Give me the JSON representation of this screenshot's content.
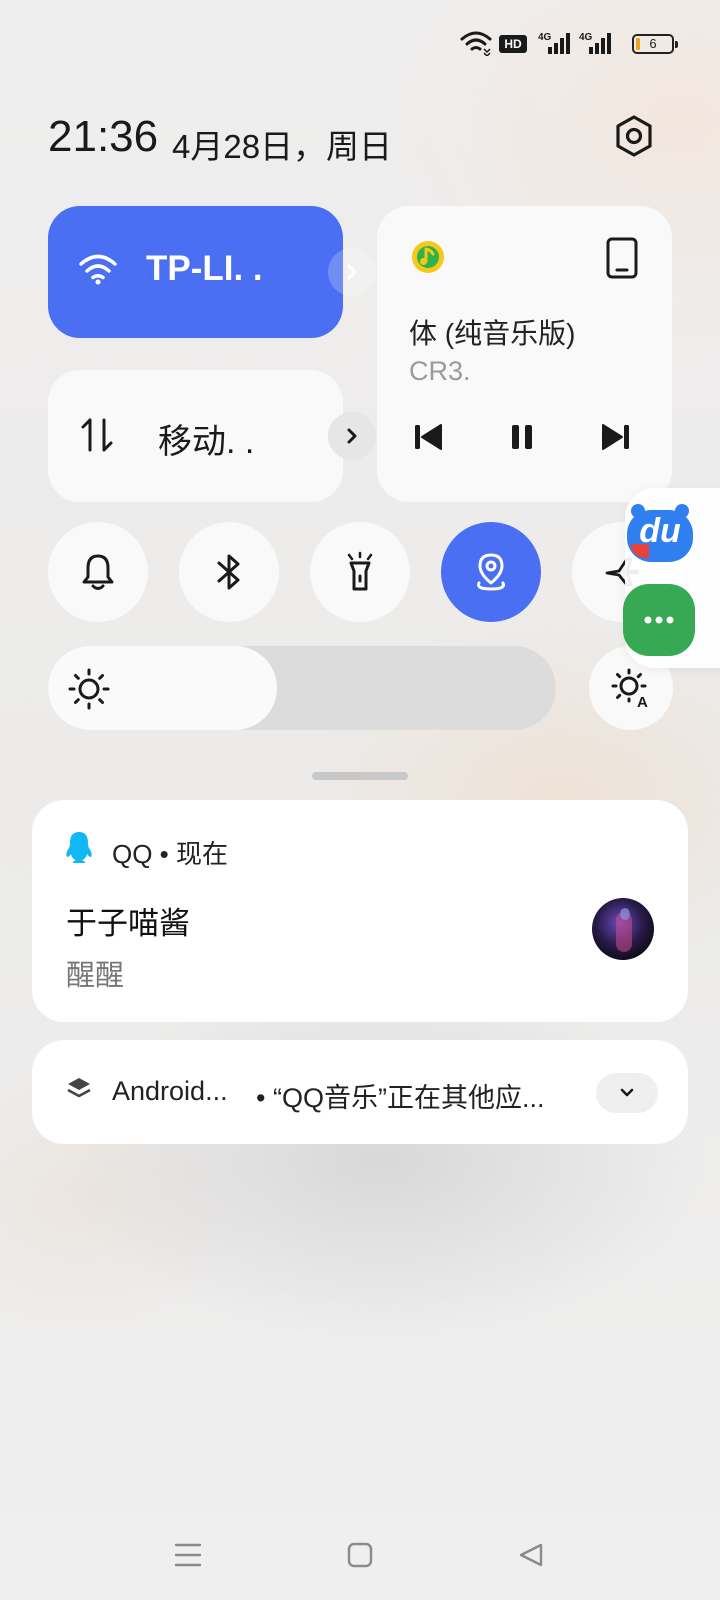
{
  "status_bar": {
    "network_badge": "HD",
    "signal_1_label": "4G",
    "signal_2_label": "4G",
    "battery_level": "6",
    "icons": [
      "wifi-icon",
      "hd-icon",
      "signal-4g-icon",
      "signal-4g-icon",
      "battery-icon"
    ]
  },
  "header": {
    "time": "21:36",
    "date": "4月28日，周日",
    "settings_icon": "settings-hex-icon"
  },
  "tiles": {
    "wifi_label": "TP-LI. .",
    "wifi_icon": "wifi-icon",
    "data_label": "移动. .",
    "data_icon": "data-arrows-icon"
  },
  "media": {
    "app_icon": "qq-music-icon",
    "output_icon": "phone-output-icon",
    "title": "体 (纯音乐版)",
    "artist": "CR3.",
    "controls": [
      "previous-icon",
      "pause-icon",
      "next-icon"
    ]
  },
  "toggles": [
    {
      "name": "bell-icon",
      "active": false
    },
    {
      "name": "bluetooth-icon",
      "active": false
    },
    {
      "name": "flashlight-icon",
      "active": false
    },
    {
      "name": "location-icon",
      "active": true
    },
    {
      "name": "airplane-icon",
      "active": false
    }
  ],
  "brightness": {
    "level": 0.45,
    "auto_icon": "auto-brightness-icon"
  },
  "floating_dock": {
    "items": [
      "baidu-du-icon",
      "chat-app-icon"
    ],
    "du_text": "du"
  },
  "notifications": [
    {
      "app": "QQ • 现在",
      "title": "于子喵酱",
      "text": "醒醒"
    },
    {
      "app": "Android...",
      "text": "• “QQ音乐”正在其他应..."
    }
  ],
  "nav_bar": [
    "menu-icon",
    "home-icon",
    "back-icon"
  ],
  "colors": {
    "accent": "#4a6ff2",
    "tile_bg": "#f9f9f9",
    "dock_green": "#37a853",
    "baidu_blue": "#2f7ff0"
  }
}
